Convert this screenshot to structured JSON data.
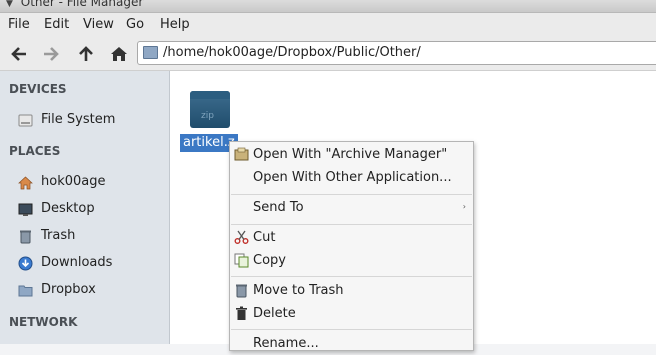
{
  "window": {
    "title": "Other - File Manager"
  },
  "menubar": {
    "items": [
      "File",
      "Edit",
      "View",
      "Go",
      "Help"
    ]
  },
  "toolbar": {
    "address": "/home/hok00age/Dropbox/Public/Other/"
  },
  "sidebar": {
    "devices_header": "DEVICES",
    "devices": [
      {
        "label": "File System",
        "icon": "drive-icon"
      }
    ],
    "places_header": "PLACES",
    "places": [
      {
        "label": "hok00age",
        "icon": "home-icon"
      },
      {
        "label": "Desktop",
        "icon": "desktop-icon"
      },
      {
        "label": "Trash",
        "icon": "trash-icon"
      },
      {
        "label": "Downloads",
        "icon": "downloads-icon"
      },
      {
        "label": "Dropbox",
        "icon": "folder-icon"
      }
    ],
    "network_header": "NETWORK"
  },
  "main": {
    "files": [
      {
        "name": "artikel.z",
        "icon": "zip-archive-icon",
        "badge": "zip",
        "selected": true
      }
    ]
  },
  "context_menu": {
    "items": [
      {
        "label": "Open With \"Archive Manager\"",
        "icon": "archive-manager-icon"
      },
      {
        "label": "Open With Other Application...",
        "icon": ""
      },
      {
        "label": "Send To",
        "icon": "",
        "submenu": "›"
      },
      {
        "label": "Cut",
        "icon": "scissors-icon"
      },
      {
        "label": "Copy",
        "icon": "copy-icon"
      },
      {
        "label": "Move to Trash",
        "icon": "trash-icon"
      },
      {
        "label": "Delete",
        "icon": "delete-icon"
      },
      {
        "label": "Rename...",
        "icon": ""
      }
    ]
  },
  "colors": {
    "selection": "#3b78c4",
    "sidebar_bg": "#dfe4ea",
    "main_bg": "#ffffff"
  }
}
